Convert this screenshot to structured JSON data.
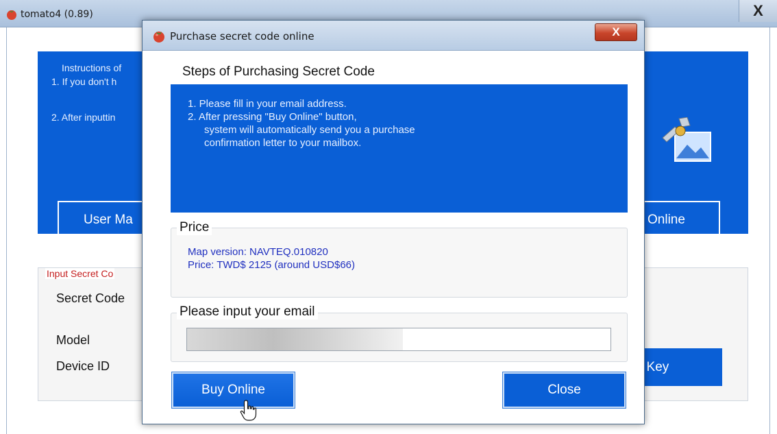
{
  "main_window": {
    "title": "tomato4 (0.89)",
    "close_label": "X",
    "instructions_title": "Instructions of",
    "instruction_1": "1. If you don't h",
    "instruction_2": "2. After inputtin",
    "user_manual_button": "User Ma",
    "buy_online_button": "Online",
    "input_section_title": "Input Secret Co",
    "secret_code_label": "Secret Code",
    "model_label": "Model",
    "device_id_label": "Device ID",
    "key_button": "t Key"
  },
  "dialog": {
    "title": "Purchase secret code online",
    "close_label": "X",
    "steps_title": "Steps of Purchasing Secret Code",
    "steps": [
      "1. Please fill in your email address.",
      "2. After pressing \"Buy Online\" button,",
      "system will automatically send you a purchase",
      "confirmation letter to your mailbox."
    ],
    "price_title": "Price",
    "price_lines": [
      "Map version: NAVTEQ.010820",
      "Price: TWD$ 2125 (around USD$66)"
    ],
    "email_title": "Please input your email",
    "email_value": "",
    "buy_online_label": "Buy Online",
    "close_button_label": "Close"
  },
  "icons": {
    "app_icon": "tomato-icon",
    "satellite_icon": "satellite-icon",
    "cursor_icon": "hand-pointer-icon"
  },
  "colors": {
    "panel_blue": "#0a5fd6",
    "price_text": "#1f2fbf",
    "input_title_red": "#c41e1e",
    "dialog_close_red": "#c9452b"
  }
}
